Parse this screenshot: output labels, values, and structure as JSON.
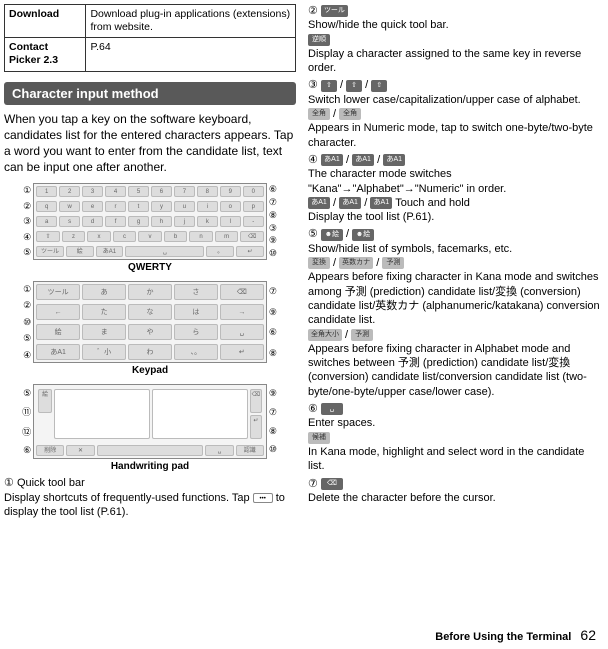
{
  "table": {
    "download_h": "Download",
    "download_d": "Download plug-in applications (extensions) from website.",
    "cp_h": "Contact Picker 2.3",
    "cp_d": "P.64"
  },
  "section_title": "Character input method",
  "intro": "When you tap a key on the software keyboard, candidates list for the entered characters appears. Tap a word you want to enter from the candidate list, text can be input one after another.",
  "figs": {
    "qwerty_caption": "QWERTY",
    "keypad_caption": "Keypad",
    "hand_caption": "Handwriting pad"
  },
  "qwerty_left": [
    "①",
    "②",
    "③",
    "④",
    "⑤"
  ],
  "qwerty_right": [
    "⑥",
    "⑦",
    "⑧",
    "③",
    "⑨",
    "⑩"
  ],
  "keypad_left": [
    "①",
    "②",
    "⑩",
    "⑤",
    "④"
  ],
  "keypad_right": [
    "⑦",
    "⑨",
    "⑥",
    "⑧"
  ],
  "hand_left": [
    "⑤",
    "⑪",
    "⑫",
    "⑥"
  ],
  "hand_right": [
    "⑨",
    "⑦",
    "⑧",
    "⑩"
  ],
  "item1": {
    "num": "①",
    "title": "Quick tool bar",
    "body": "Display shortcuts of frequently-used functions. Tap ",
    "body2": " to display the tool list (P.61)."
  },
  "right": {
    "i2": {
      "num": "②",
      "k": "ツール",
      "l1": "Show/hide the quick tool bar.",
      "k2": "逆順",
      "l2": "Display a character assigned to the same key in reverse order."
    },
    "i3": {
      "num": "③",
      "l1": "Switch lower case/capitalization/upper case of alphabet.",
      "k_a": "⇧",
      "k_b": "⇧",
      "k_c": "⇧",
      "k_d": "全角",
      "k_e": "全角",
      "l2": "Appears in Numeric mode, tap to switch one-byte/two-byte character."
    },
    "i4": {
      "num": "④",
      "l1": "The character mode switches \"Kana\"→\"Alphabet\"→\"Numeric\" in order.",
      "k_a": "あA1",
      "k_b": "あA1",
      "k_c": "あA1",
      "k_d": "あA1",
      "k_e": "あA1",
      "k_f": "あA1",
      "tail": " Touch and hold",
      "l2": "Display the tool list (P.61)."
    },
    "i5": {
      "num": "⑤",
      "k_a": "☻絵",
      "k_b": "☻絵",
      "l1": "Show/hide list of symbols, facemarks, etc.",
      "k_c": "変換",
      "k_d": "英数カナ",
      "k_e": "予測",
      "l2": "Appears before fixing character in Kana mode and switches among 予測 (prediction) candidate list/変換 (conversion) candidate list/英数カナ (alphanumeric/katakana) conversion candidate list.",
      "k_f": "全角大小",
      "k_g": "予測",
      "l3": "Appears before fixing character in Alphabet mode and switches between 予測 (prediction) candidate list/変換 (conversion) candidate list/conversion candidate list (two-byte/one-byte/upper case/lower case)."
    },
    "i6": {
      "num": "⑥",
      "k": "␣",
      "l1": "Enter spaces.",
      "k2": "候補",
      "l2": "In Kana mode, highlight and select word in the candidate list."
    },
    "i7": {
      "num": "⑦",
      "k": "⌫",
      "l1": "Delete the character before the cursor."
    }
  },
  "footer": {
    "title": "Before Using the Terminal",
    "page": "62"
  }
}
